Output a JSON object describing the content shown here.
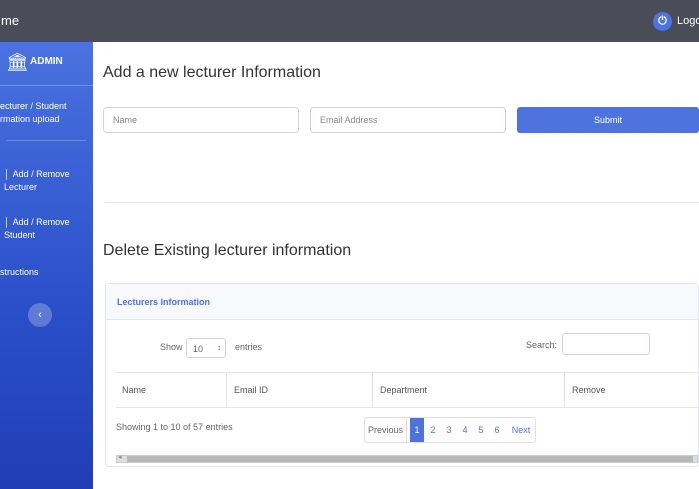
{
  "topbar": {
    "brand": "me",
    "logout_icon": "power-icon",
    "logout_label": "Logout"
  },
  "sidebar": {
    "brand_icon": "university-icon",
    "brand": "ADMIN",
    "items": [
      {
        "line1": "ecturer / Student",
        "line2": "rmation upload"
      },
      {
        "label": "Add / Remove Lecturer"
      },
      {
        "label": "Add / Remove Student"
      },
      {
        "label": "structions"
      }
    ],
    "collapse_icon": "chevron-left-icon"
  },
  "add_form": {
    "heading": "Add a new lecturer Information",
    "name_placeholder": "Name",
    "email_placeholder": "Email Address",
    "submit_label": "Submit"
  },
  "delete_section": {
    "heading": "Delete Existing lecturer information",
    "card_title": "Lecturers Information",
    "show_label": "Show",
    "entries_value": "10",
    "entries_label": "entries",
    "search_label": "Search:",
    "columns": [
      "Name",
      "Email ID",
      "Department",
      "Remove"
    ],
    "info": "Showing 1 to 10 of 57 entries",
    "pagination": {
      "previous": "Previous",
      "pages": [
        "1",
        "2",
        "3",
        "4",
        "5",
        "6"
      ],
      "active": "1",
      "next": "Next"
    }
  },
  "colors": {
    "accent": "#4e73df",
    "topbar": "#4a4d57"
  }
}
